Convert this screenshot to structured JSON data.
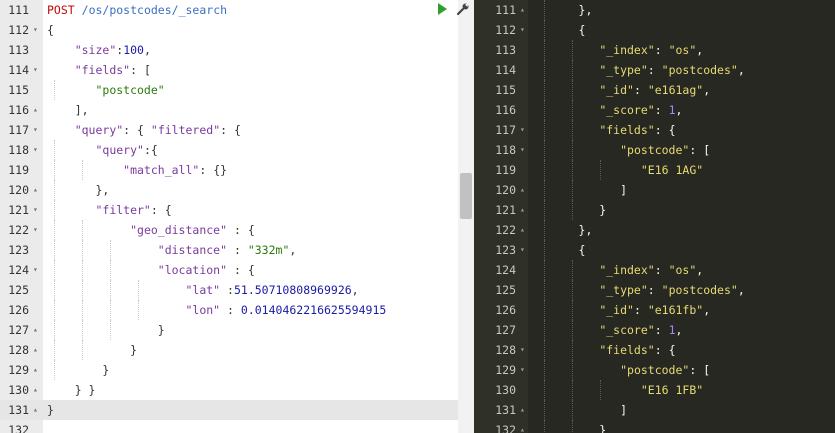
{
  "request_editor": {
    "lines": [
      {
        "num": "111",
        "fold": "",
        "text": "POST /os/postcodes/_search"
      },
      {
        "num": "112",
        "fold": "▾",
        "text": "{"
      },
      {
        "num": "113",
        "fold": "",
        "text": "    \"size\":100,"
      },
      {
        "num": "114",
        "fold": "▾",
        "text": "    \"fields\": ["
      },
      {
        "num": "115",
        "fold": "",
        "text": "       \"postcode\""
      },
      {
        "num": "116",
        "fold": "▴",
        "text": "    ],"
      },
      {
        "num": "117",
        "fold": "▾",
        "text": "    \"query\": { \"filtered\": {"
      },
      {
        "num": "118",
        "fold": "▾",
        "text": "       \"query\":{"
      },
      {
        "num": "119",
        "fold": "",
        "text": "           \"match_all\": {}"
      },
      {
        "num": "120",
        "fold": "▴",
        "text": "       },"
      },
      {
        "num": "121",
        "fold": "▾",
        "text": "       \"filter\": {"
      },
      {
        "num": "122",
        "fold": "▾",
        "text": "            \"geo_distance\" : {"
      },
      {
        "num": "123",
        "fold": "",
        "text": "                \"distance\" : \"332m\","
      },
      {
        "num": "124",
        "fold": "▾",
        "text": "                \"location\" : {"
      },
      {
        "num": "125",
        "fold": "",
        "text": "                    \"lat\" :51.50710808969926,"
      },
      {
        "num": "126",
        "fold": "",
        "text": "                    \"lon\" : 0.0140462216625594915"
      },
      {
        "num": "127",
        "fold": "▴",
        "text": "                }"
      },
      {
        "num": "128",
        "fold": "▴",
        "text": "            }"
      },
      {
        "num": "129",
        "fold": "▴",
        "text": "        }"
      },
      {
        "num": "130",
        "fold": "▴",
        "text": "    } }"
      },
      {
        "num": "131",
        "fold": "▴",
        "text": "}"
      },
      {
        "num": "132",
        "fold": "",
        "text": ""
      }
    ],
    "method": "POST",
    "path": "/os/postcodes/_search",
    "run_icon": "play-icon",
    "settings_icon": "wrench-icon",
    "active_line": "131",
    "colors": {
      "method": "#c5060b",
      "path": "#3a6fc4",
      "key": "#7a3a9e",
      "string": "#2b7a0b",
      "number": "#1a1aa6"
    }
  },
  "response_viewer": {
    "lines": [
      {
        "num": "111",
        "fold": "▴",
        "text": "      },"
      },
      {
        "num": "112",
        "fold": "▾",
        "text": "      {"
      },
      {
        "num": "113",
        "fold": "",
        "text": "         \"_index\": \"os\","
      },
      {
        "num": "114",
        "fold": "",
        "text": "         \"_type\": \"postcodes\","
      },
      {
        "num": "115",
        "fold": "",
        "text": "         \"_id\": \"e161ag\","
      },
      {
        "num": "116",
        "fold": "",
        "text": "         \"_score\": 1,"
      },
      {
        "num": "117",
        "fold": "▾",
        "text": "         \"fields\": {"
      },
      {
        "num": "118",
        "fold": "▾",
        "text": "            \"postcode\": ["
      },
      {
        "num": "119",
        "fold": "",
        "text": "               \"E16 1AG\""
      },
      {
        "num": "120",
        "fold": "▴",
        "text": "            ]"
      },
      {
        "num": "121",
        "fold": "▴",
        "text": "         }"
      },
      {
        "num": "122",
        "fold": "▴",
        "text": "      },"
      },
      {
        "num": "123",
        "fold": "▾",
        "text": "      {"
      },
      {
        "num": "124",
        "fold": "",
        "text": "         \"_index\": \"os\","
      },
      {
        "num": "125",
        "fold": "",
        "text": "         \"_type\": \"postcodes\","
      },
      {
        "num": "126",
        "fold": "",
        "text": "         \"_id\": \"e161fb\","
      },
      {
        "num": "127",
        "fold": "",
        "text": "         \"_score\": 1,"
      },
      {
        "num": "128",
        "fold": "▾",
        "text": "         \"fields\": {"
      },
      {
        "num": "129",
        "fold": "▾",
        "text": "            \"postcode\": ["
      },
      {
        "num": "130",
        "fold": "",
        "text": "               \"E16 1FB\""
      },
      {
        "num": "131",
        "fold": "▴",
        "text": "            ]"
      },
      {
        "num": "132",
        "fold": "▴",
        "text": "         }"
      }
    ],
    "colors": {
      "background": "#272822",
      "string": "#e6db74",
      "number": "#ae81ff"
    }
  }
}
